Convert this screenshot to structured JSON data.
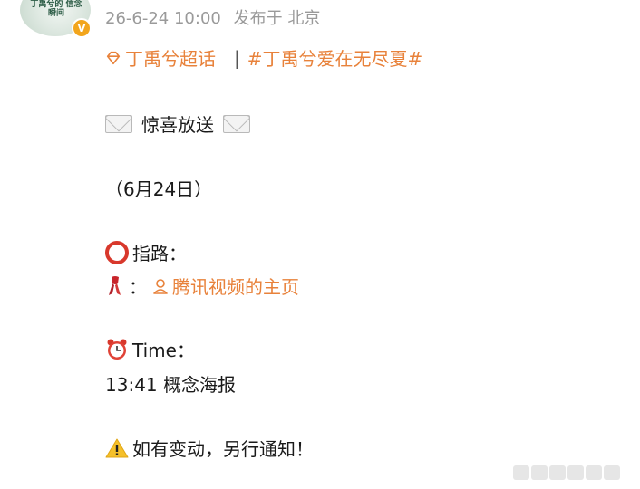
{
  "post": {
    "avatar_caption": "丁禹兮的 信念瞬间",
    "date": "26-6-24 10:00",
    "source": "发布于 北京"
  },
  "tags": {
    "supertopic": "丁禹兮超话",
    "separator": "|",
    "hashtag": "#丁禹兮爱在无尽夏#"
  },
  "content": {
    "announce": "惊喜放送",
    "date_paren": "（6月24日）",
    "guide_label": "指路：",
    "colon": "：",
    "homepage_link": "腾讯视频的主页",
    "time_label": "Time：",
    "time_value": "13:41 概念海报",
    "notice": "如有变动，另行通知！"
  }
}
